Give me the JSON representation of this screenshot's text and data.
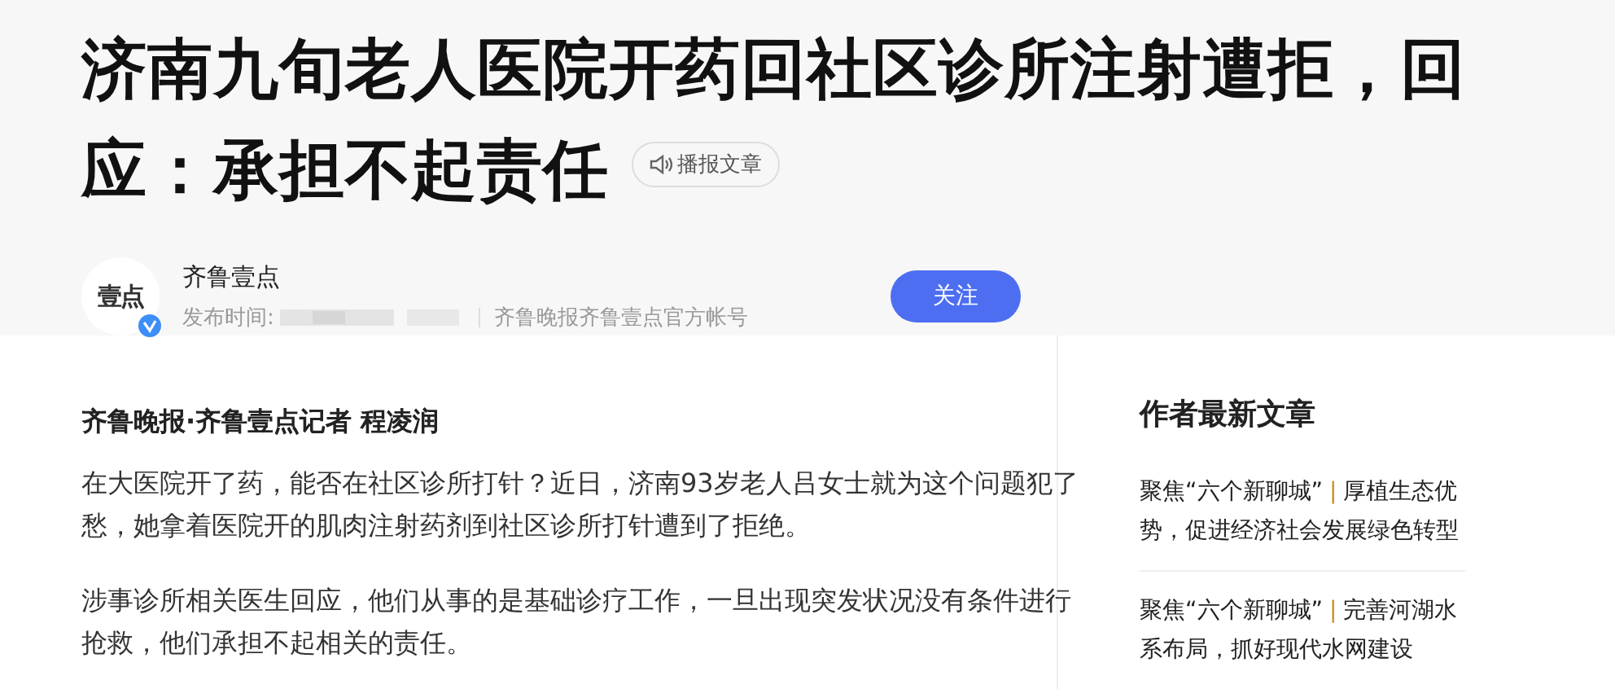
{
  "article": {
    "title": "济南九旬老人医院开药回社区诊所注射遭拒，回应：承担不起责任",
    "listen_button": "播报文章"
  },
  "author": {
    "logo_text": "壹点",
    "verified": true,
    "name": "齐鲁壹点",
    "publish_label": "发布时间:",
    "source": "齐鲁晚报齐鲁壹点官方帐号",
    "follow_button": "关注"
  },
  "byline": "齐鲁晚报·齐鲁壹点记者 程凌润",
  "paragraphs": [
    "在大医院开了药，能否在社区诊所打针？近日，济南93岁老人吕女士就为这个问题犯了愁，她拿着医院开的肌肉注射药剂到社区诊所打针遭到了拒绝。",
    "涉事诊所相关医生回应，他们从事的是基础诊疗工作，一旦出现突发状况没有条件进行抢救，他们承担不起相关的责任。"
  ],
  "sidebar": {
    "heading": "作者最新文章",
    "articles": [
      {
        "topic": "聚焦“六个新聊城”",
        "separator": "|",
        "title": "厚植生态优势，促进经济社会发展绿色转型"
      },
      {
        "topic": "聚焦“六个新聊城”",
        "separator": "|",
        "title": "完善河湖水系布局，抓好现代水网建设"
      }
    ]
  }
}
